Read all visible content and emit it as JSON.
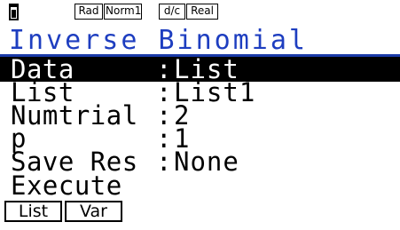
{
  "status_bar": {
    "battery_icon": "battery-icon",
    "angle": "Rad",
    "display": "Norm1",
    "fraction": "d/c",
    "complex": "Real"
  },
  "title": "Inverse Binomial",
  "rows": [
    {
      "label": "Data",
      "value": "List"
    },
    {
      "label": "List",
      "value": "List1"
    },
    {
      "label": "Numtrial",
      "value": "2"
    },
    {
      "label": "p",
      "value": "1"
    },
    {
      "label": "Save Res",
      "value": "None"
    }
  ],
  "separator": ":",
  "execute_label": "Execute",
  "function_keys": [
    "List",
    "Var"
  ],
  "colors": {
    "title_text": "#1e3ec0",
    "title_rule": "#1a3aa8",
    "selection_bg": "#000000"
  }
}
